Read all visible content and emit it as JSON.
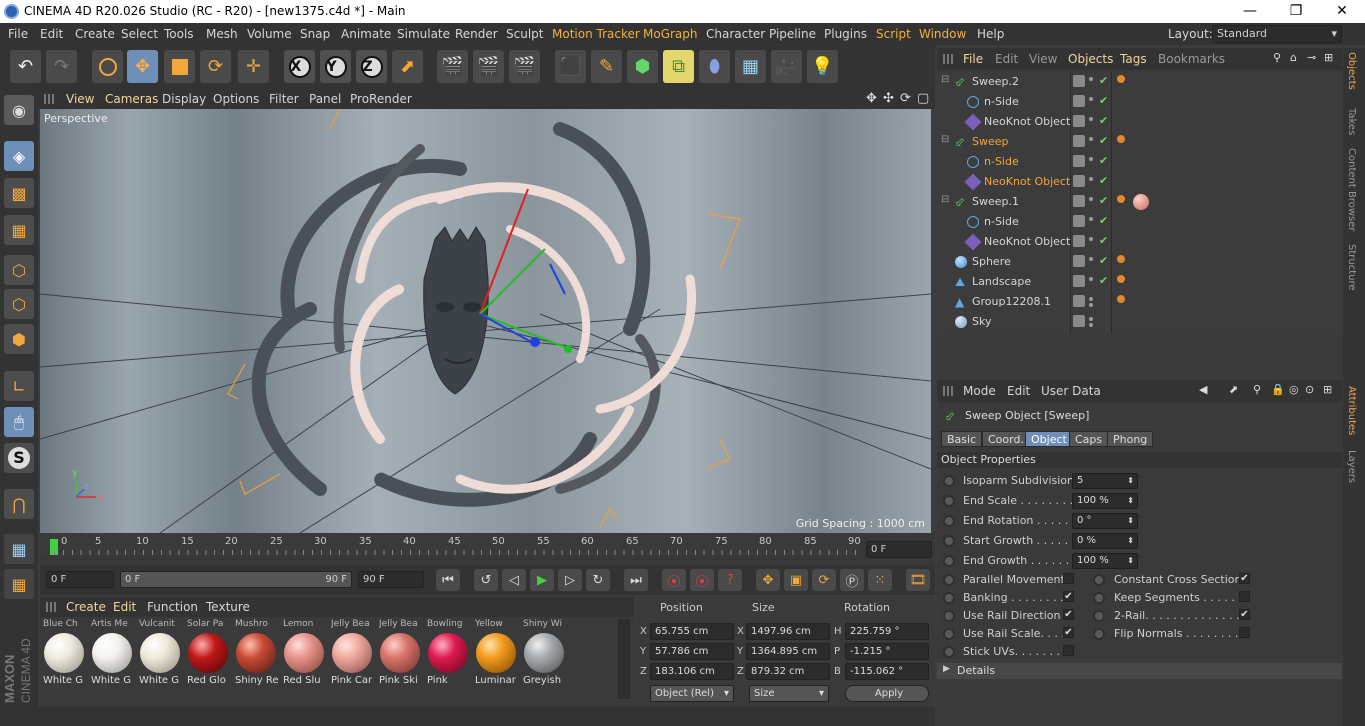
{
  "titlebar": {
    "title": "CINEMA 4D R20.026 Studio (RC - R20) - [new1375.c4d *] - Main",
    "minimize": "—",
    "maximize": "❐",
    "close": "✕"
  },
  "menubar": {
    "items": [
      "File",
      "Edit",
      "Create",
      "Select",
      "Tools",
      "Mesh",
      "Volume",
      "Snap",
      "Animate",
      "Simulate",
      "Render",
      "Sculpt",
      "Motion Tracker",
      "MoGraph",
      "Character",
      "Pipeline",
      "Plugins",
      "Script",
      "Window",
      "Help"
    ],
    "layout_label": "Layout:",
    "layout_value": "Standard"
  },
  "viewport": {
    "menu": [
      "View",
      "Cameras",
      "Display",
      "Options",
      "Filter",
      "Panel",
      "ProRender"
    ],
    "label": "Perspective",
    "grid_spacing": "Grid Spacing : 1000 cm"
  },
  "timeline": {
    "ticks": [
      "0",
      "5",
      "10",
      "15",
      "20",
      "25",
      "30",
      "35",
      "40",
      "45",
      "50",
      "55",
      "60",
      "65",
      "70",
      "75",
      "80",
      "85",
      "90"
    ],
    "current": "0 F"
  },
  "anim": {
    "start": "0 F",
    "range_start": "0 F",
    "range_end": "90 F",
    "end": "90 F"
  },
  "materials": {
    "menu": [
      "Create",
      "Edit",
      "Function",
      "Texture"
    ],
    "top_labels": [
      "Blue Ch",
      "Artis Me",
      "Vulcanit",
      "Solar Pa",
      "Mushro",
      "Lemon",
      "Jelly Bea",
      "Jelly Bea",
      "Bowling",
      "Yellow",
      "Shiny Wi"
    ],
    "items": [
      {
        "name": "White G",
        "color": "#f0ebe0"
      },
      {
        "name": "White G",
        "color": "#f4f2ee"
      },
      {
        "name": "White G",
        "color": "#efe9da"
      },
      {
        "name": "Red Glo",
        "color": "#c01818"
      },
      {
        "name": "Shiny Re",
        "color": "#c84a35"
      },
      {
        "name": "Red Slu",
        "color": "#e8938a"
      },
      {
        "name": "Pink Car",
        "color": "#f0a89e"
      },
      {
        "name": "Pink Ski",
        "color": "#d9746a"
      },
      {
        "name": "Pink",
        "color": "#e0194f"
      },
      {
        "name": "Luminar",
        "color": "#f39a1c"
      },
      {
        "name": "Greyish",
        "color": "#a7aaae"
      }
    ]
  },
  "coords": {
    "position": "Position",
    "size": "Size",
    "rotation": "Rotation",
    "rows": [
      {
        "axis": "X",
        "pos": "65.755 cm",
        "saxis": "X",
        "size": "1497.96 cm",
        "raxis": "H",
        "rot": "225.759 °"
      },
      {
        "axis": "Y",
        "pos": "57.786 cm",
        "saxis": "Y",
        "size": "1364.895 cm",
        "raxis": "P",
        "rot": "-1.215 °"
      },
      {
        "axis": "Z",
        "pos": "183.106 cm",
        "saxis": "Z",
        "size": "879.32 cm",
        "raxis": "B",
        "rot": "-115.062 °"
      }
    ],
    "mode": "Object (Rel)",
    "size_mode": "Size",
    "apply": "Apply"
  },
  "objmgr": {
    "menu": [
      "File",
      "Edit",
      "View",
      "Objects",
      "Tags",
      "Bookmarks"
    ],
    "rows": [
      {
        "name": "Sweep.2",
        "indent": 0,
        "type": "sweep"
      },
      {
        "name": "n-Side",
        "indent": 1,
        "type": "spline"
      },
      {
        "name": "NeoKnot Object",
        "indent": 1,
        "type": "knot"
      },
      {
        "name": "Sweep",
        "indent": 0,
        "type": "sweep",
        "hl": true
      },
      {
        "name": "n-Side",
        "indent": 1,
        "type": "spline",
        "hl": true
      },
      {
        "name": "NeoKnot Object",
        "indent": 1,
        "type": "knot",
        "hl": true
      },
      {
        "name": "Sweep.1",
        "indent": 0,
        "type": "sweep"
      },
      {
        "name": "n-Side",
        "indent": 1,
        "type": "spline"
      },
      {
        "name": "NeoKnot Object",
        "indent": 1,
        "type": "knot"
      },
      {
        "name": "Sphere",
        "indent": 0,
        "type": "sphere"
      },
      {
        "name": "Landscape",
        "indent": 0,
        "type": "landscape"
      },
      {
        "name": "Group12208.1",
        "indent": 0,
        "type": "group"
      },
      {
        "name": "Sky",
        "indent": 0,
        "type": "sky"
      }
    ]
  },
  "dock": {
    "tabs": [
      "Objects",
      "Takes",
      "Content Browser",
      "Structure"
    ],
    "tabs2": [
      "Attributes",
      "Layers"
    ]
  },
  "attr": {
    "menu": [
      "Mode",
      "Edit",
      "User Data"
    ],
    "object_title": "Sweep Object [Sweep]",
    "tabs": [
      "Basic",
      "Coord.",
      "Object",
      "Caps",
      "Phong"
    ],
    "section": "Object Properties",
    "fields": [
      {
        "label": "Isoparm Subdivision",
        "value": "5"
      },
      {
        "label": "End Scale . . . . . . . . . .",
        "value": "100 %"
      },
      {
        "label": "End Rotation . . . . . . .",
        "value": "0 °"
      },
      {
        "label": "Start Growth . . . . . . .",
        "value": "0 %"
      },
      {
        "label": "End Growth . . . . . . . .",
        "value": "100 %"
      }
    ],
    "checks_left": [
      {
        "label": "Parallel Movement",
        "checked": false
      },
      {
        "label": "Banking . . . . . . . . .",
        "checked": true
      },
      {
        "label": "Use Rail Direction",
        "checked": true
      },
      {
        "label": "Use Rail Scale. . . .",
        "checked": true
      },
      {
        "label": "Stick UVs. . . . . . . .",
        "checked": false
      }
    ],
    "checks_right": [
      {
        "label": "Constant Cross Section",
        "checked": true
      },
      {
        "label": "Keep Segments . . . . . . .",
        "checked": false
      },
      {
        "label": "2-Rail. . . . . . . . . . . . . .",
        "checked": true
      },
      {
        "label": "Flip Normals . . . . . . . . .",
        "checked": false
      }
    ],
    "details": "Details"
  },
  "maxon": {
    "brand": "MAXON",
    "product": "CINEMA 4D"
  }
}
